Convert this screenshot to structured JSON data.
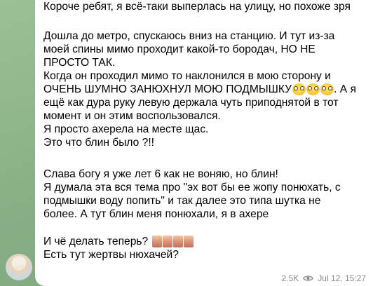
{
  "message": {
    "lines": [
      "Короче ребят, я всё-таки выперлась на улицу, но похоже зря",
      "Дошла до метро, спускаюсь вниз на станцию. И тут из-за",
      "моей спины мимо проходит какой-то бородач, НО НЕ",
      "ПРОСТО ТАК.",
      "Когда он проходил мимо то наклонился в мою сторону и",
      "ОЧЕНЬ ШУМНО ЗАНЮХНУЛ МОЮ ПОДМЫШКУ",
      ". А я",
      "ещё как дура руку левую держала чуть приподнятой в тот",
      "момент и он этим воспользовался.",
      "Я просто ахерела на месте щас.",
      "Это что блин было ?!!",
      "Слава богу я уже лет 6 как не воняю, но блин!",
      "Я думала эта вся тема про \"эх вот бы ее жопу понюхать, с",
      "подмышки воду попить\" и так далее это типа шутка не",
      "более. А тут блин меня понюхали, я в ахере",
      "И чё делать теперь?",
      "Есть тут жертвы нюхачей?"
    ]
  },
  "meta": {
    "views": "2.5K",
    "time": "Jul 12, 15:27"
  },
  "icons": {
    "views": "eye-icon",
    "emoji": "surprised-face-emoji",
    "sticker": "photo-thumbnail"
  },
  "colors": {
    "background": "#8fb58a",
    "bubble": "#ffffff",
    "meta": "#8c8c8c"
  }
}
